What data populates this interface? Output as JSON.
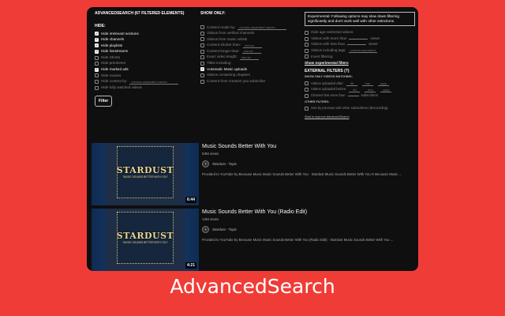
{
  "colors": {
    "background": "#f03c36",
    "panel": "#0f0f0f",
    "text": "#f2f2f2",
    "muted": "#888888"
  },
  "header": "ADVANCEDSEARCH (67 FILTERED ELEMENTS)",
  "hide": {
    "label": "HIDE:",
    "items": [
      {
        "label": "Hide irrelevant sections",
        "checked": true
      },
      {
        "label": "Hide channels",
        "checked": true
      },
      {
        "label": "Hide playlists",
        "checked": true
      },
      {
        "label": "Hide livestreams",
        "checked": true
      },
      {
        "label": "Hide Shorts",
        "checked": false
      },
      {
        "label": "Hide premieres",
        "checked": false
      },
      {
        "label": "Hide marked ads",
        "checked": true
      },
      {
        "label": "Hide movies",
        "checked": false
      },
      {
        "label": "Hide content by:",
        "checked": false,
        "placeholder": "comma-separated names"
      },
      {
        "label": "Hide fully watched videos",
        "checked": false
      }
    ],
    "filter_button": "Filter"
  },
  "show_only": {
    "label": "SHOW ONLY:",
    "items": [
      {
        "label": "Content made by:",
        "checked": false,
        "placeholder": "comma-separated names"
      },
      {
        "label": "Videos from verified channels",
        "checked": false
      },
      {
        "label": "Videos from music artists",
        "checked": false
      },
      {
        "label": "Content shorter than:",
        "checked": false,
        "placeholder": "mm:ss"
      },
      {
        "label": "Content longer than:",
        "checked": false,
        "placeholder": "mm:ss"
      },
      {
        "label": "Exact video length:",
        "checked": false,
        "placeholder": "mm:ss"
      },
      {
        "label": "Titles including:",
        "checked": false
      },
      {
        "label": "Automatic Music uploads",
        "checked": true
      },
      {
        "label": "Videos containing chapters",
        "checked": false
      },
      {
        "label": "Content from creators you subscribe",
        "checked": false
      }
    ]
  },
  "experimental": {
    "warning": "Experimental: Following options may slow down filtering significantly and don't work well with other selections.",
    "items": [
      {
        "label": "Hide age-restricted videos",
        "checked": false
      },
      {
        "label": "Videos with more than",
        "checked": false,
        "suffix": "views"
      },
      {
        "label": "Videos with less than",
        "checked": false,
        "suffix": "views"
      },
      {
        "label": "Videos including tags:",
        "checked": false,
        "placeholder": "comma-separated"
      },
      {
        "label": "Invert filtering",
        "checked": false
      }
    ],
    "show_link": "Show experimental filters"
  },
  "external": {
    "title": "EXTERNAL FILTERS (?)",
    "subtitle": "SHOW ONLY VIDEOS MATCHING:",
    "items": [
      {
        "label": "Videos uploaded after:",
        "checked": false,
        "fields": [
          "dd",
          "mm",
          "yyyy"
        ]
      },
      {
        "label": "Videos uploaded before:",
        "checked": false,
        "fields": [
          "dd",
          "mm",
          "yyyy"
        ]
      },
      {
        "label": "Channel has more than",
        "checked": false,
        "suffix": "subscribers"
      }
    ],
    "other_label": "OTHER FILTERS:",
    "other_item": {
      "label": "Sort by previous with other subscribers (descending)",
      "checked": false
    },
    "contact_link": "Start to improve AdvancedSearch"
  },
  "videos": [
    {
      "title": "Music Sounds Better With You",
      "views": "53M views",
      "channel": "Stardust - Topic",
      "description": "Provided to YouTube by Because Music Music Sounds Better With You · Stardust Music Sounds Better With You ℗ Because Music ...",
      "duration": "6:44",
      "thumb_title": "STARDUST",
      "thumb_sub": "\"MUSIC SOUNDS BETTER WITH YOU\""
    },
    {
      "title": "Music Sounds Better With You (Radio Edit)",
      "views": "13M views",
      "channel": "Stardust - Topic",
      "description": "Provided to YouTube by Because Music Music Sounds Better With You (Radio Edit) · Stardust Music Sounds Better With You ...",
      "duration": "4:21",
      "thumb_title": "STARDUST",
      "thumb_sub": "\"MUSIC SOUNDS BETTER WITH YOU\""
    }
  ],
  "brand": "AdvancedSearch"
}
